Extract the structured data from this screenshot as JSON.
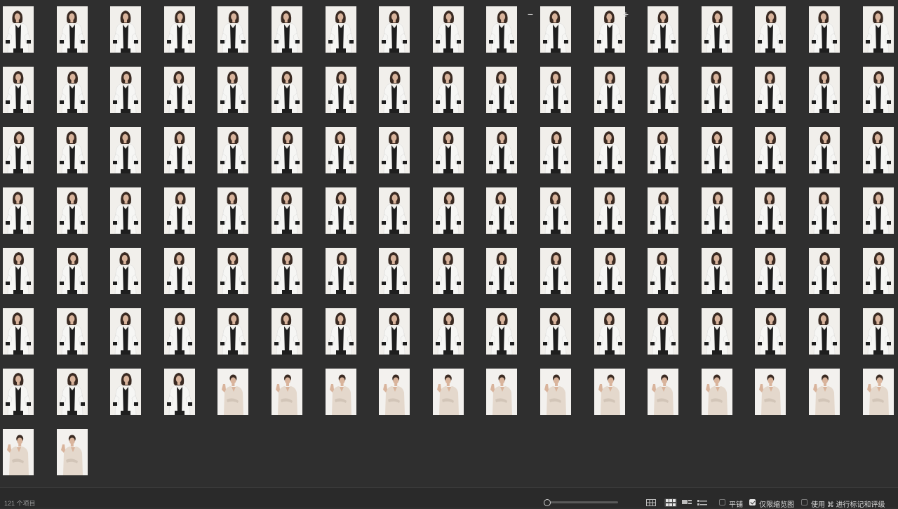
{
  "status": {
    "item_count": "121 个项目"
  },
  "gallery": {
    "total": 121,
    "columns": 17,
    "thumbnails": [
      {
        "kind": "jacket"
      },
      {
        "kind": "jacket"
      },
      {
        "kind": "jacket"
      },
      {
        "kind": "jacket"
      },
      {
        "kind": "jacket"
      },
      {
        "kind": "jacket"
      },
      {
        "kind": "jacket"
      },
      {
        "kind": "jacket"
      },
      {
        "kind": "jacket"
      },
      {
        "kind": "jacket"
      },
      {
        "kind": "jacket"
      },
      {
        "kind": "jacket"
      },
      {
        "kind": "jacket"
      },
      {
        "kind": "jacket"
      },
      {
        "kind": "jacket"
      },
      {
        "kind": "jacket"
      },
      {
        "kind": "jacket"
      },
      {
        "kind": "jacket"
      },
      {
        "kind": "jacket"
      },
      {
        "kind": "jacket"
      },
      {
        "kind": "jacket"
      },
      {
        "kind": "jacket"
      },
      {
        "kind": "jacket"
      },
      {
        "kind": "jacket"
      },
      {
        "kind": "jacket"
      },
      {
        "kind": "jacket"
      },
      {
        "kind": "jacket"
      },
      {
        "kind": "jacket"
      },
      {
        "kind": "jacket"
      },
      {
        "kind": "jacket"
      },
      {
        "kind": "jacket"
      },
      {
        "kind": "jacket"
      },
      {
        "kind": "jacket"
      },
      {
        "kind": "jacket"
      },
      {
        "kind": "jacket"
      },
      {
        "kind": "jacket"
      },
      {
        "kind": "jacket"
      },
      {
        "kind": "jacket"
      },
      {
        "kind": "jacket"
      },
      {
        "kind": "jacket"
      },
      {
        "kind": "jacket"
      },
      {
        "kind": "jacket"
      },
      {
        "kind": "jacket"
      },
      {
        "kind": "jacket"
      },
      {
        "kind": "jacket"
      },
      {
        "kind": "jacket"
      },
      {
        "kind": "jacket"
      },
      {
        "kind": "jacket"
      },
      {
        "kind": "jacket"
      },
      {
        "kind": "jacket"
      },
      {
        "kind": "jacket"
      },
      {
        "kind": "jacket"
      },
      {
        "kind": "jacket"
      },
      {
        "kind": "jacket"
      },
      {
        "kind": "jacket"
      },
      {
        "kind": "jacket"
      },
      {
        "kind": "jacket"
      },
      {
        "kind": "jacket"
      },
      {
        "kind": "jacket"
      },
      {
        "kind": "jacket"
      },
      {
        "kind": "jacket"
      },
      {
        "kind": "jacket"
      },
      {
        "kind": "jacket"
      },
      {
        "kind": "jacket"
      },
      {
        "kind": "jacket"
      },
      {
        "kind": "jacket"
      },
      {
        "kind": "jacket"
      },
      {
        "kind": "jacket"
      },
      {
        "kind": "jacket"
      },
      {
        "kind": "jacket"
      },
      {
        "kind": "jacket"
      },
      {
        "kind": "jacket"
      },
      {
        "kind": "jacket"
      },
      {
        "kind": "jacket"
      },
      {
        "kind": "jacket"
      },
      {
        "kind": "jacket"
      },
      {
        "kind": "jacket"
      },
      {
        "kind": "jacket"
      },
      {
        "kind": "jacket"
      },
      {
        "kind": "jacket"
      },
      {
        "kind": "jacket"
      },
      {
        "kind": "jacket"
      },
      {
        "kind": "jacket"
      },
      {
        "kind": "jacket"
      },
      {
        "kind": "jacket"
      },
      {
        "kind": "jacket"
      },
      {
        "kind": "jacket"
      },
      {
        "kind": "jacket"
      },
      {
        "kind": "jacket"
      },
      {
        "kind": "jacket"
      },
      {
        "kind": "jacket"
      },
      {
        "kind": "jacket"
      },
      {
        "kind": "jacket"
      },
      {
        "kind": "jacket"
      },
      {
        "kind": "jacket"
      },
      {
        "kind": "jacket"
      },
      {
        "kind": "jacket"
      },
      {
        "kind": "jacket"
      },
      {
        "kind": "jacket"
      },
      {
        "kind": "jacket"
      },
      {
        "kind": "jacket"
      },
      {
        "kind": "jacket"
      },
      {
        "kind": "jacket"
      },
      {
        "kind": "jacket"
      },
      {
        "kind": "jacket"
      },
      {
        "kind": "jacket"
      },
      {
        "kind": "blouse"
      },
      {
        "kind": "blouse"
      },
      {
        "kind": "blouse"
      },
      {
        "kind": "blouse"
      },
      {
        "kind": "blouse"
      },
      {
        "kind": "blouse"
      },
      {
        "kind": "blouse"
      },
      {
        "kind": "blouse"
      },
      {
        "kind": "blouse"
      },
      {
        "kind": "blouse"
      },
      {
        "kind": "blouse"
      },
      {
        "kind": "blouse"
      },
      {
        "kind": "blouse"
      },
      {
        "kind": "blouse"
      },
      {
        "kind": "blouse"
      }
    ]
  },
  "toolbar": {
    "zoom_out_label": "−",
    "zoom_in_label": "+",
    "zoom_level": 0.02,
    "view_modes": [
      "grid-large-icon",
      "grid-small-icon",
      "filmstrip-icon",
      "list-icon"
    ],
    "active_view": 1,
    "tile_label": "平铺",
    "tile_checked": false,
    "thumbs_only_label": "仅限缩览图",
    "thumbs_only_checked": true,
    "use_shortcut_label": "使用 ⌘ 进行标记和评级",
    "use_shortcut_checked": false
  },
  "colors": {
    "background": "#2f2f2f",
    "statusbar": "#2a2a2a",
    "photo_bg": "#f1efeb",
    "jacket": "#f6f6f4",
    "top": "#1e1e1e",
    "hair": "#3a2a22",
    "skin": "#d9b49c",
    "blouse": "#e4d8cc"
  }
}
